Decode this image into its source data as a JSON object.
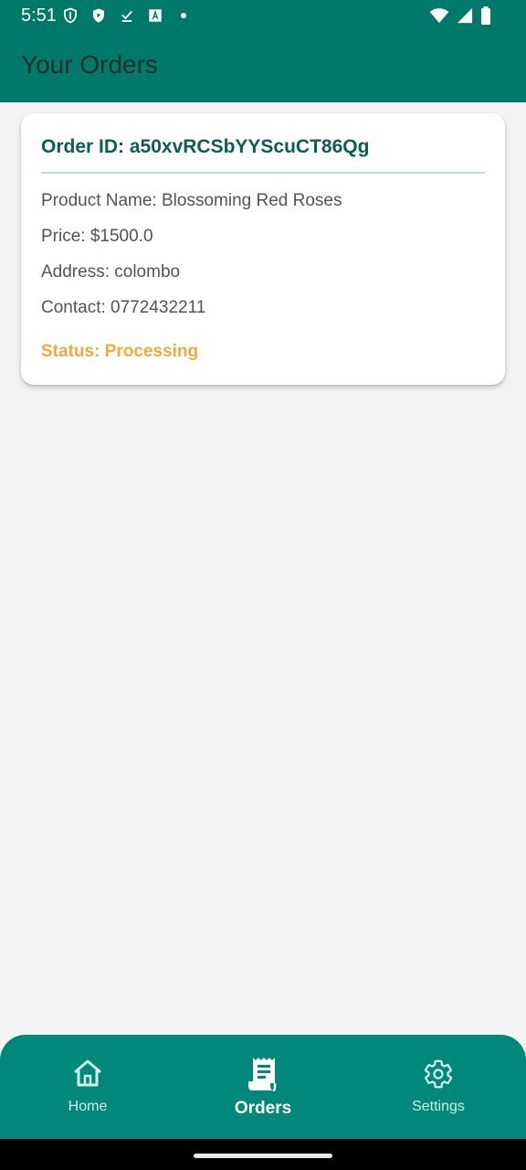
{
  "status_bar": {
    "time": "5:51",
    "left_icons": [
      "shield-icon",
      "play-shield-icon",
      "download-done-icon",
      "translate-icon",
      "dot-icon"
    ],
    "right_icons": [
      "wifi-icon",
      "signal-icon",
      "battery-icon"
    ]
  },
  "app_bar": {
    "title": "Your Orders",
    "background": "#00796b"
  },
  "orders": [
    {
      "order_id_text": "Order ID: a50xvRCSbYYScuCT86Qg",
      "product_text": "Product Name: Blossoming  Red Roses",
      "price_text": "Price: $1500.0",
      "address_text": "Address: colombo",
      "contact_text": "Contact: 0772432211",
      "status_text": "Status: Processing",
      "status_color": "#f2a93b"
    }
  ],
  "bottom_nav": {
    "background": "#00897b",
    "items": [
      {
        "label": "Home",
        "icon": "home-icon",
        "active": false
      },
      {
        "label": "Orders",
        "icon": "receipt-icon",
        "active": true
      },
      {
        "label": "Settings",
        "icon": "gear-icon",
        "active": false
      }
    ]
  }
}
